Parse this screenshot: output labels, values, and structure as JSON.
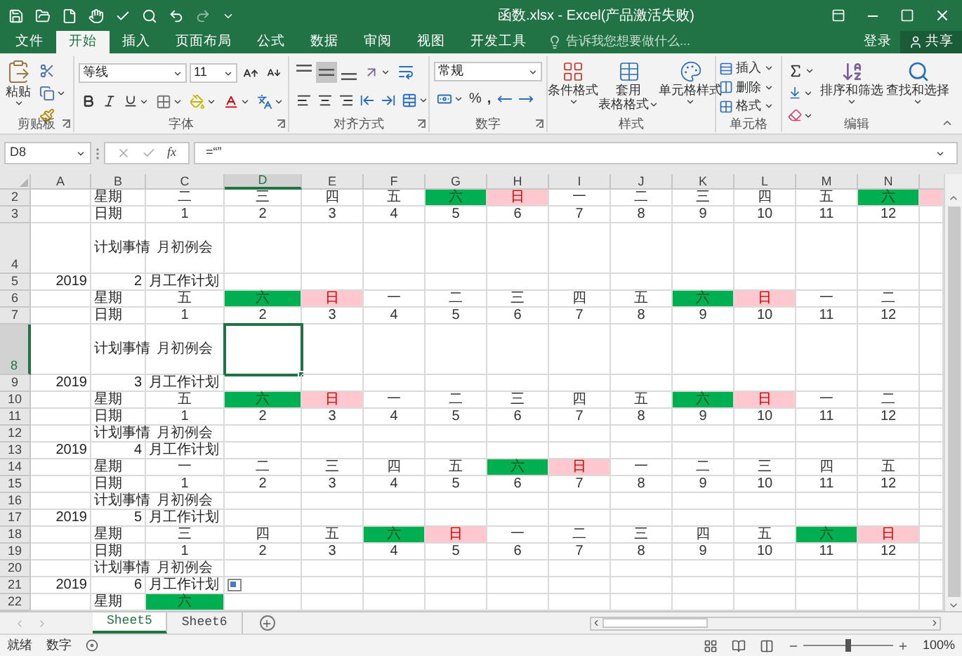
{
  "window": {
    "title": "函数.xlsx - Excel(产品激活失败)"
  },
  "menu_tabs": [
    {
      "label": "文件",
      "selected": false
    },
    {
      "label": "开始",
      "selected": true
    },
    {
      "label": "插入",
      "selected": false
    },
    {
      "label": "页面布局",
      "selected": false
    },
    {
      "label": "公式",
      "selected": false
    },
    {
      "label": "数据",
      "selected": false
    },
    {
      "label": "审阅",
      "selected": false
    },
    {
      "label": "视图",
      "selected": false
    },
    {
      "label": "开发工具",
      "selected": false
    }
  ],
  "tell_me": {
    "placeholder": "告诉我您想要做什么..."
  },
  "account": {
    "sign_in": "登录",
    "share": "共享"
  },
  "ribbon": {
    "groups": [
      {
        "kind": "clipboard",
        "label": "剪贴板",
        "paste": "粘贴"
      },
      {
        "kind": "font",
        "label": "字体",
        "font_name": "等线",
        "font_size": "11"
      },
      {
        "kind": "alignment",
        "label": "对齐方式",
        "vertical_align": [
          {
            "kind": "top",
            "selected": false
          },
          {
            "kind": "middle",
            "selected": true
          },
          {
            "kind": "bottom",
            "selected": false
          }
        ]
      },
      {
        "kind": "number",
        "label": "数字",
        "format": "常规",
        "percent": "%",
        "comma": ","
      },
      {
        "kind": "styles",
        "label": "样式",
        "buttons": [
          {
            "lines": [
              "条件格式"
            ]
          },
          {
            "lines": [
              "套用",
              "表格格式"
            ]
          },
          {
            "lines": [
              "单元格样式"
            ]
          }
        ]
      },
      {
        "kind": "cells",
        "label": "单元格",
        "buttons": [
          "插入",
          "删除",
          "格式"
        ]
      },
      {
        "kind": "editing",
        "label": "编辑",
        "buttons": [
          "排序和筛选",
          "查找和选择"
        ]
      }
    ]
  },
  "formula_bar": {
    "name_box": "D8",
    "function_label": "fx",
    "formula": "=“”"
  },
  "grid": {
    "columns": [
      {
        "label": "A",
        "selected": false
      },
      {
        "label": "B",
        "selected": false
      },
      {
        "label": "C",
        "selected": false
      },
      {
        "label": "D",
        "selected": true
      },
      {
        "label": "E",
        "selected": false
      },
      {
        "label": "F",
        "selected": false
      },
      {
        "label": "G",
        "selected": false
      },
      {
        "label": "H",
        "selected": false
      },
      {
        "label": "I",
        "selected": false
      },
      {
        "label": "J",
        "selected": false
      },
      {
        "label": "K",
        "selected": false
      },
      {
        "label": "L",
        "selected": false
      },
      {
        "label": "M",
        "selected": false
      },
      {
        "label": "N",
        "selected": false
      }
    ],
    "rows": [
      {
        "num": "2",
        "kind": "normal",
        "selected": false,
        "cells": [
          null,
          {
            "text": "星期",
            "kind": "label"
          },
          {
            "text": "二",
            "kind": "center"
          },
          {
            "text": "三",
            "kind": "center"
          },
          {
            "text": "四",
            "kind": "center"
          },
          {
            "text": "五",
            "kind": "center"
          },
          {
            "text": "六",
            "kind": "sat"
          },
          {
            "text": "日",
            "kind": "sun"
          },
          {
            "text": "一",
            "kind": "center"
          },
          {
            "text": "二",
            "kind": "center"
          },
          {
            "text": "三",
            "kind": "center"
          },
          {
            "text": "四",
            "kind": "center"
          },
          {
            "text": "五",
            "kind": "center"
          },
          {
            "text": "六",
            "kind": "sat"
          },
          {
            "kind": "sun"
          }
        ]
      },
      {
        "num": "3",
        "kind": "normal",
        "selected": false,
        "cells": [
          null,
          {
            "text": "日期",
            "kind": "label"
          },
          {
            "text": "1",
            "kind": "center"
          },
          {
            "text": "2",
            "kind": "center"
          },
          {
            "text": "3",
            "kind": "center"
          },
          {
            "text": "4",
            "kind": "center"
          },
          {
            "text": "5",
            "kind": "center"
          },
          {
            "text": "6",
            "kind": "center"
          },
          {
            "text": "7",
            "kind": "center"
          },
          {
            "text": "8",
            "kind": "center"
          },
          {
            "text": "9",
            "kind": "center"
          },
          {
            "text": "10",
            "kind": "center"
          },
          {
            "text": "11",
            "kind": "center"
          },
          {
            "text": "12",
            "kind": "center"
          },
          null
        ]
      },
      {
        "num": "4",
        "kind": "tall",
        "selected": false,
        "cells": [
          null,
          {
            "text": "计划事情",
            "kind": "label"
          },
          {
            "text": "月初例会",
            "kind": "center"
          },
          null,
          null,
          null,
          null,
          null,
          null,
          null,
          null,
          null,
          null,
          null,
          null
        ]
      },
      {
        "num": "5",
        "kind": "normal",
        "selected": false,
        "cells": [
          {
            "text": "2019",
            "kind": "num"
          },
          {
            "text": "2",
            "kind": "num"
          },
          {
            "text": "月工作计划",
            "kind": "label"
          },
          null,
          null,
          null,
          null,
          null,
          null,
          null,
          null,
          null,
          null,
          null,
          null
        ]
      },
      {
        "num": "6",
        "kind": "normal",
        "selected": false,
        "cells": [
          null,
          {
            "text": "星期",
            "kind": "label"
          },
          {
            "text": "五",
            "kind": "center"
          },
          {
            "text": "六",
            "kind": "sat"
          },
          {
            "text": "日",
            "kind": "sun"
          },
          {
            "text": "一",
            "kind": "center"
          },
          {
            "text": "二",
            "kind": "center"
          },
          {
            "text": "三",
            "kind": "center"
          },
          {
            "text": "四",
            "kind": "center"
          },
          {
            "text": "五",
            "kind": "center"
          },
          {
            "text": "六",
            "kind": "sat"
          },
          {
            "text": "日",
            "kind": "sun"
          },
          {
            "text": "一",
            "kind": "center"
          },
          {
            "text": "二",
            "kind": "center"
          },
          null
        ]
      },
      {
        "num": "7",
        "kind": "normal",
        "selected": false,
        "cells": [
          null,
          {
            "text": "日期",
            "kind": "label"
          },
          {
            "text": "1",
            "kind": "center"
          },
          {
            "text": "2",
            "kind": "center"
          },
          {
            "text": "3",
            "kind": "center"
          },
          {
            "text": "4",
            "kind": "center"
          },
          {
            "text": "5",
            "kind": "center"
          },
          {
            "text": "6",
            "kind": "center"
          },
          {
            "text": "7",
            "kind": "center"
          },
          {
            "text": "8",
            "kind": "center"
          },
          {
            "text": "9",
            "kind": "center"
          },
          {
            "text": "10",
            "kind": "center"
          },
          {
            "text": "11",
            "kind": "center"
          },
          {
            "text": "12",
            "kind": "center"
          },
          null
        ]
      },
      {
        "num": "8",
        "kind": "tall",
        "selected": true,
        "cells": [
          null,
          {
            "text": "计划事情",
            "kind": "label"
          },
          {
            "text": "月初例会",
            "kind": "center"
          },
          null,
          null,
          null,
          null,
          null,
          null,
          null,
          null,
          null,
          null,
          null,
          null
        ]
      },
      {
        "num": "9",
        "kind": "normal",
        "selected": false,
        "cells": [
          {
            "text": "2019",
            "kind": "num"
          },
          {
            "text": "3",
            "kind": "num"
          },
          {
            "text": "月工作计划",
            "kind": "label"
          },
          null,
          null,
          null,
          null,
          null,
          null,
          null,
          null,
          null,
          null,
          null,
          null
        ]
      },
      {
        "num": "10",
        "kind": "normal",
        "selected": false,
        "cells": [
          null,
          {
            "text": "星期",
            "kind": "label"
          },
          {
            "text": "五",
            "kind": "center"
          },
          {
            "text": "六",
            "kind": "sat"
          },
          {
            "text": "日",
            "kind": "sun"
          },
          {
            "text": "一",
            "kind": "center"
          },
          {
            "text": "二",
            "kind": "center"
          },
          {
            "text": "三",
            "kind": "center"
          },
          {
            "text": "四",
            "kind": "center"
          },
          {
            "text": "五",
            "kind": "center"
          },
          {
            "text": "六",
            "kind": "sat"
          },
          {
            "text": "日",
            "kind": "sun"
          },
          {
            "text": "一",
            "kind": "center"
          },
          {
            "text": "二",
            "kind": "center"
          },
          null
        ]
      },
      {
        "num": "11",
        "kind": "normal",
        "selected": false,
        "cells": [
          null,
          {
            "text": "日期",
            "kind": "label"
          },
          {
            "text": "1",
            "kind": "center"
          },
          {
            "text": "2",
            "kind": "center"
          },
          {
            "text": "3",
            "kind": "center"
          },
          {
            "text": "4",
            "kind": "center"
          },
          {
            "text": "5",
            "kind": "center"
          },
          {
            "text": "6",
            "kind": "center"
          },
          {
            "text": "7",
            "kind": "center"
          },
          {
            "text": "8",
            "kind": "center"
          },
          {
            "text": "9",
            "kind": "center"
          },
          {
            "text": "10",
            "kind": "center"
          },
          {
            "text": "11",
            "kind": "center"
          },
          {
            "text": "12",
            "kind": "center"
          },
          null
        ]
      },
      {
        "num": "12",
        "kind": "normal",
        "selected": false,
        "cells": [
          null,
          {
            "text": "计划事情",
            "kind": "label"
          },
          {
            "text": "月初例会",
            "kind": "center"
          },
          null,
          null,
          null,
          null,
          null,
          null,
          null,
          null,
          null,
          null,
          null,
          null
        ]
      },
      {
        "num": "13",
        "kind": "normal",
        "selected": false,
        "cells": [
          {
            "text": "2019",
            "kind": "num"
          },
          {
            "text": "4",
            "kind": "num"
          },
          {
            "text": "月工作计划",
            "kind": "label"
          },
          null,
          null,
          null,
          null,
          null,
          null,
          null,
          null,
          null,
          null,
          null,
          null
        ]
      },
      {
        "num": "14",
        "kind": "normal",
        "selected": false,
        "cells": [
          null,
          {
            "text": "星期",
            "kind": "label"
          },
          {
            "text": "一",
            "kind": "center"
          },
          {
            "text": "二",
            "kind": "center"
          },
          {
            "text": "三",
            "kind": "center"
          },
          {
            "text": "四",
            "kind": "center"
          },
          {
            "text": "五",
            "kind": "center"
          },
          {
            "text": "六",
            "kind": "sat"
          },
          {
            "text": "日",
            "kind": "sun"
          },
          {
            "text": "一",
            "kind": "center"
          },
          {
            "text": "二",
            "kind": "center"
          },
          {
            "text": "三",
            "kind": "center"
          },
          {
            "text": "四",
            "kind": "center"
          },
          {
            "text": "五",
            "kind": "center"
          },
          null
        ]
      },
      {
        "num": "15",
        "kind": "normal",
        "selected": false,
        "cells": [
          null,
          {
            "text": "日期",
            "kind": "label"
          },
          {
            "text": "1",
            "kind": "center"
          },
          {
            "text": "2",
            "kind": "center"
          },
          {
            "text": "3",
            "kind": "center"
          },
          {
            "text": "4",
            "kind": "center"
          },
          {
            "text": "5",
            "kind": "center"
          },
          {
            "text": "6",
            "kind": "center"
          },
          {
            "text": "7",
            "kind": "center"
          },
          {
            "text": "8",
            "kind": "center"
          },
          {
            "text": "9",
            "kind": "center"
          },
          {
            "text": "10",
            "kind": "center"
          },
          {
            "text": "11",
            "kind": "center"
          },
          {
            "text": "12",
            "kind": "center"
          },
          null
        ]
      },
      {
        "num": "16",
        "kind": "normal",
        "selected": false,
        "cells": [
          null,
          {
            "text": "计划事情",
            "kind": "label"
          },
          {
            "text": "月初例会",
            "kind": "center"
          },
          null,
          null,
          null,
          null,
          null,
          null,
          null,
          null,
          null,
          null,
          null,
          null
        ]
      },
      {
        "num": "17",
        "kind": "normal",
        "selected": false,
        "cells": [
          {
            "text": "2019",
            "kind": "num"
          },
          {
            "text": "5",
            "kind": "num"
          },
          {
            "text": "月工作计划",
            "kind": "label"
          },
          null,
          null,
          null,
          null,
          null,
          null,
          null,
          null,
          null,
          null,
          null,
          null
        ]
      },
      {
        "num": "18",
        "kind": "normal",
        "selected": false,
        "cells": [
          null,
          {
            "text": "星期",
            "kind": "label"
          },
          {
            "text": "三",
            "kind": "center"
          },
          {
            "text": "四",
            "kind": "center"
          },
          {
            "text": "五",
            "kind": "center"
          },
          {
            "text": "六",
            "kind": "sat"
          },
          {
            "text": "日",
            "kind": "sun"
          },
          {
            "text": "一",
            "kind": "center"
          },
          {
            "text": "二",
            "kind": "center"
          },
          {
            "text": "三",
            "kind": "center"
          },
          {
            "text": "四",
            "kind": "center"
          },
          {
            "text": "五",
            "kind": "center"
          },
          {
            "text": "六",
            "kind": "sat"
          },
          {
            "text": "日",
            "kind": "sun"
          },
          null
        ]
      },
      {
        "num": "19",
        "kind": "normal",
        "selected": false,
        "cells": [
          null,
          {
            "text": "日期",
            "kind": "label"
          },
          {
            "text": "1",
            "kind": "center"
          },
          {
            "text": "2",
            "kind": "center"
          },
          {
            "text": "3",
            "kind": "center"
          },
          {
            "text": "4",
            "kind": "center"
          },
          {
            "text": "5",
            "kind": "center"
          },
          {
            "text": "6",
            "kind": "center"
          },
          {
            "text": "7",
            "kind": "center"
          },
          {
            "text": "8",
            "kind": "center"
          },
          {
            "text": "9",
            "kind": "center"
          },
          {
            "text": "10",
            "kind": "center"
          },
          {
            "text": "11",
            "kind": "center"
          },
          {
            "text": "12",
            "kind": "center"
          },
          null
        ]
      },
      {
        "num": "20",
        "kind": "normal",
        "selected": false,
        "cells": [
          null,
          {
            "text": "计划事情",
            "kind": "label"
          },
          {
            "text": "月初例会",
            "kind": "center"
          },
          null,
          null,
          null,
          null,
          null,
          null,
          null,
          null,
          null,
          null,
          null,
          null
        ]
      },
      {
        "num": "21",
        "kind": "normal",
        "selected": false,
        "cells": [
          {
            "text": "2019",
            "kind": "num"
          },
          {
            "text": "6",
            "kind": "num"
          },
          {
            "text": "月工作计划",
            "kind": "label"
          },
          null,
          null,
          null,
          null,
          null,
          null,
          null,
          null,
          null,
          null,
          null,
          null
        ]
      },
      {
        "num": "22",
        "kind": "normal",
        "selected": false,
        "cells": [
          null,
          {
            "text": "星期",
            "kind": "label"
          },
          {
            "text": "六",
            "kind": "sat"
          },
          null,
          null,
          null,
          null,
          null,
          null,
          null,
          null,
          null,
          null,
          null,
          null
        ]
      }
    ]
  },
  "sheet_tabs": [
    {
      "label": "Sheet5",
      "selected": true
    },
    {
      "label": "Sheet6",
      "selected": false
    }
  ],
  "status_bar": {
    "status": "就绪",
    "mode": "数字",
    "zoom": {
      "level": 0.5,
      "reading": "100%"
    }
  }
}
